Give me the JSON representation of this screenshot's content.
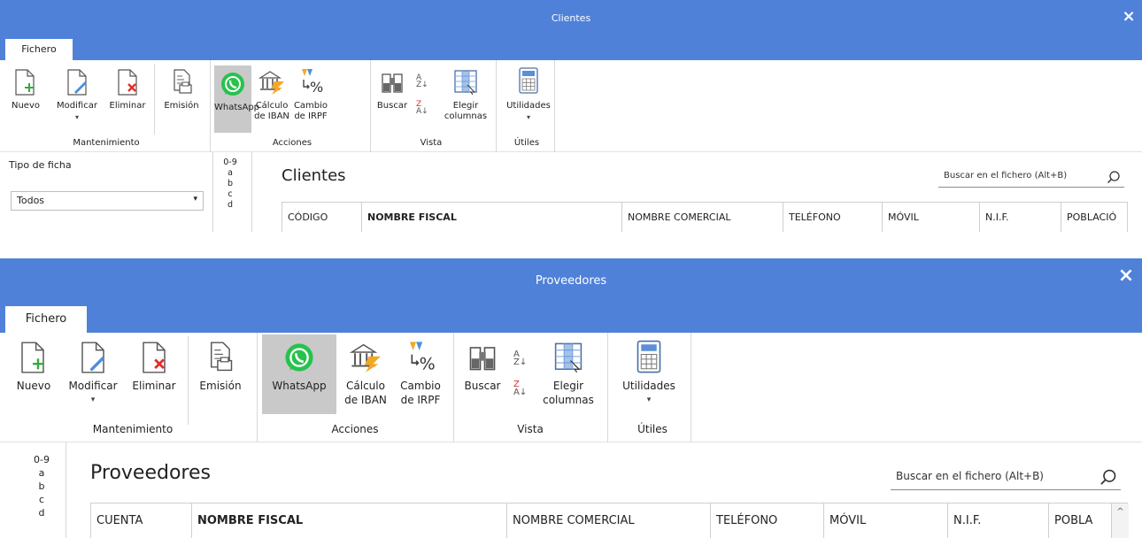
{
  "colors": {
    "titlebar": "#4f81d9",
    "active_button": "#c9c9c9",
    "whatsapp_green": "#27c24c"
  },
  "windows": [
    {
      "title": "Clientes",
      "close": "×",
      "tab": "Fichero",
      "ribbon": {
        "nuevo": "Nuevo",
        "modificar": "Modificar",
        "eliminar": "Eliminar",
        "emision": "Emisión",
        "whatsapp": "WhatsApp",
        "calculo_l1": "Cálculo",
        "calculo_l2": "de IBAN",
        "cambio_l1": "Cambio",
        "cambio_l2": "de IRPF",
        "buscar": "Buscar",
        "elegir_l1": "Elegir",
        "elegir_l2": "columnas",
        "utilidades": "Utilidades",
        "groups": {
          "mantenimiento": "Mantenimiento",
          "acciones": "Acciones",
          "vista": "Vista",
          "utiles": "Útiles"
        }
      },
      "filter": {
        "label": "Tipo de ficha",
        "value": "Todos"
      },
      "alpha": [
        "0-9",
        "a",
        "b",
        "c",
        "d"
      ],
      "heading": "Clientes",
      "search_placeholder": "Buscar en el fichero (Alt+B)",
      "columns": [
        "CÓDIGO",
        "NOMBRE FISCAL",
        "NOMBRE COMERCIAL",
        "TELÉFONO",
        "MÓVIL",
        "N.I.F.",
        "POBLACIÓ"
      ]
    },
    {
      "title": "Proveedores",
      "close": "×",
      "tab": "Fichero",
      "ribbon": {
        "nuevo": "Nuevo",
        "modificar": "Modificar",
        "eliminar": "Eliminar",
        "emision": "Emisión",
        "whatsapp": "WhatsApp",
        "calculo_l1": "Cálculo",
        "calculo_l2": "de IBAN",
        "cambio_l1": "Cambio",
        "cambio_l2": "de IRPF",
        "buscar": "Buscar",
        "elegir_l1": "Elegir",
        "elegir_l2": "columnas",
        "utilidades": "Utilidades",
        "groups": {
          "mantenimiento": "Mantenimiento",
          "acciones": "Acciones",
          "vista": "Vista",
          "utiles": "Útiles"
        }
      },
      "alpha": [
        "0-9",
        "a",
        "b",
        "c",
        "d"
      ],
      "heading": "Proveedores",
      "search_placeholder": "Buscar en el fichero (Alt+B)",
      "columns": [
        "CUENTA",
        "NOMBRE FISCAL",
        "NOMBRE COMERCIAL",
        "TELÉFONO",
        "MÓVIL",
        "N.I.F.",
        "POBLA"
      ]
    }
  ]
}
